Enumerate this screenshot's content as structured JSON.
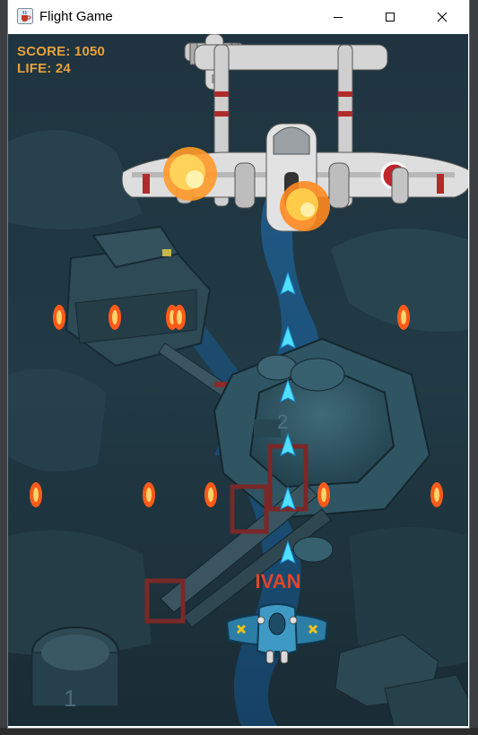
{
  "window": {
    "title": "Flight Game",
    "icon": "java-cup-icon"
  },
  "titlebar_controls": {
    "minimize_icon": "minimize-icon",
    "maximize_icon": "maximize-icon",
    "close_icon": "close-icon"
  },
  "hud": {
    "score": "SCORE: 1050",
    "life": "LIFE: 24"
  },
  "player": {
    "name": "IVAN"
  },
  "colors": {
    "hud_text": "#e8a13a",
    "player_name": "#e0452a",
    "bullet": "#4fe0ff",
    "enemy_bullet": "#ff5a1a"
  },
  "terrain": {
    "tower_marking_2": "2",
    "tower_marking_1": "1"
  }
}
